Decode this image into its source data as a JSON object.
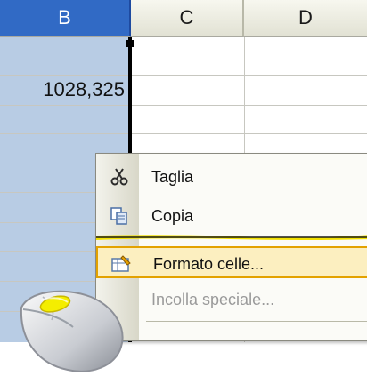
{
  "columns": [
    "B",
    "C",
    "D"
  ],
  "cell": {
    "value": "1028,325"
  },
  "menu": {
    "items": [
      {
        "label": "Taglia",
        "icon": "scissors-icon",
        "enabled": true
      },
      {
        "label": "Copia",
        "icon": "copy-icon",
        "enabled": true
      },
      {
        "label": "Formato celle...",
        "icon": "format-cells-icon",
        "enabled": true,
        "highlighted": true
      },
      {
        "label": "Incolla speciale...",
        "icon": "",
        "enabled": false
      }
    ]
  },
  "colors": {
    "selected_header": "#316ac5",
    "selection_fill": "#b8cce4",
    "menu_highlight": "#fcefc0",
    "menu_highlight_border": "#e3a200"
  }
}
